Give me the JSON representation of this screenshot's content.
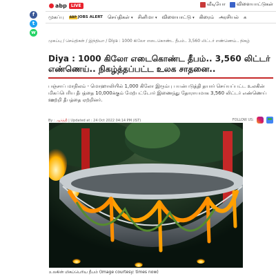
{
  "share": [
    {
      "name": "facebook-icon",
      "glyph": "f",
      "color": "#3b5998"
    },
    {
      "name": "twitter-icon",
      "glyph": "t",
      "color": "#1da1f2"
    },
    {
      "name": "whatsapp-icon",
      "glyph": "w",
      "color": "#25d366"
    }
  ],
  "header": {
    "logo_text": "abp",
    "live": "LIVE",
    "video": "வீடியோ",
    "games": "விளையாட்டுகள்"
  },
  "nav": {
    "home": "முகப்பு",
    "jobs_logo": "ABP",
    "jobs": "JOBS ALERT",
    "news": "செய்திகள்",
    "cinema": "சினிமா",
    "sports": "விளையாட்டு",
    "cricket": "கிரைம்",
    "politics": "அரசியல்",
    "more": "க"
  },
  "breadcrumb": "முகப்பு / செய்திகள் / இந்தியா / Diya : 1000 கிலோ எடைகொண்ட தீபம்.. 3,560 லிட்டர் எண்ணெய்.. நிகழ்",
  "headline": "Diya : 1000 கிலோ எடைகொண்ட தீபம்.. 3,560 லிட்டர் எண்ணெய்.. நிகழ்த்தப்பட்ட உலக சாதனை..",
  "summary": "பஞ்சாப் மாநிலம் - மொஹாலியில் 1,000 கிலோ இரும்பு பயன்படுத்தி தயார் செய்யப்பட்ட உலகின் மிகப்பெரிய தீபத்தை 10,000க்கும் மேற்பட்டோர் இணைந்து தோராயமாக 3,560 லிட்டர் எண்ணெய் ஊற்றி தீபத்தை ஏற்றினர்.",
  "meta": {
    "by": "By :",
    "author": "ஆர்த்தி",
    "updated": " | Updated at : 24 Oct 2022 04:14 PM (IST)",
    "follow": "FOLLOW US:"
  },
  "caption": "உலகின் மிகப்பெரிய தீபம் (Image courtesy: times now)"
}
